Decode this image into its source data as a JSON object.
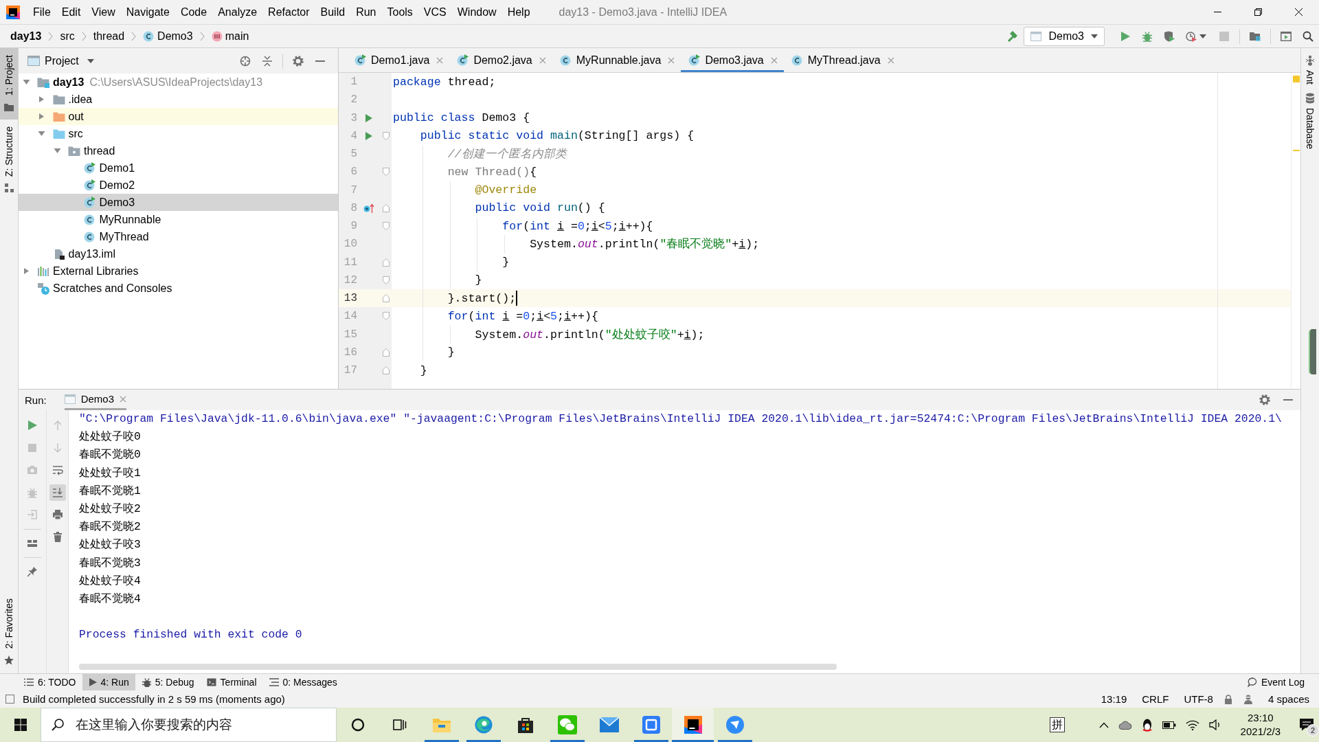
{
  "window": {
    "title": "day13 - Demo3.java - IntelliJ IDEA"
  },
  "menu": [
    "File",
    "Edit",
    "View",
    "Navigate",
    "Code",
    "Analyze",
    "Refactor",
    "Build",
    "Run",
    "Tools",
    "VCS",
    "Window",
    "Help"
  ],
  "breadcrumbs": [
    {
      "label": "day13",
      "kind": "project"
    },
    {
      "label": "src",
      "kind": "folder"
    },
    {
      "label": "thread",
      "kind": "folder"
    },
    {
      "label": "Demo3",
      "kind": "class"
    },
    {
      "label": "main",
      "kind": "method"
    }
  ],
  "toolbar": {
    "run_config": "Demo3",
    "buttons": [
      {
        "kind": "run",
        "disabled": false
      },
      {
        "kind": "debug",
        "disabled": false
      },
      {
        "kind": "coverage",
        "disabled": false
      },
      {
        "kind": "profile",
        "disabled": false
      },
      {
        "kind": "stop",
        "disabled": true
      },
      {
        "kind": "project-structure",
        "disabled": false
      },
      {
        "kind": "presentation",
        "disabled": false
      },
      {
        "kind": "search",
        "disabled": false
      }
    ]
  },
  "left_tool_tabs": [
    {
      "label": "1: Project",
      "kind": "project",
      "selected": true
    },
    {
      "label": "Z: Structure",
      "kind": "structure",
      "selected": false
    }
  ],
  "favorites_tab": {
    "label": "2: Favorites"
  },
  "right_tool_tabs": [
    {
      "label": "Ant",
      "kind": "ant"
    },
    {
      "label": "Database",
      "kind": "database"
    }
  ],
  "project_panel": {
    "title": "Project",
    "tree": [
      {
        "label": "day13",
        "path": "C:\\Users\\ASUS\\IdeaProjects\\day13",
        "kind": "module",
        "expanded": true,
        "selected": false,
        "children": [
          {
            "label": ".idea",
            "kind": "folder",
            "expanded": false,
            "selected": false
          },
          {
            "label": "out",
            "kind": "excluded-folder",
            "expanded": false,
            "selected": false
          },
          {
            "label": "src",
            "kind": "source-folder",
            "expanded": true,
            "selected": false,
            "children": [
              {
                "label": "thread",
                "kind": "package",
                "expanded": true,
                "selected": false,
                "children": [
                  {
                    "label": "Demo1",
                    "kind": "runnable-class",
                    "selected": false
                  },
                  {
                    "label": "Demo2",
                    "kind": "runnable-class",
                    "selected": false
                  },
                  {
                    "label": "Demo3",
                    "kind": "runnable-class",
                    "selected": true
                  },
                  {
                    "label": "MyRunnable",
                    "kind": "class",
                    "selected": false
                  },
                  {
                    "label": "MyThread",
                    "kind": "class",
                    "selected": false
                  }
                ]
              }
            ]
          },
          {
            "label": "day13.iml",
            "kind": "module-file",
            "selected": false
          }
        ]
      },
      {
        "label": "External Libraries",
        "kind": "libraries",
        "expanded": false,
        "selected": false
      },
      {
        "label": "Scratches and Consoles",
        "kind": "scratches",
        "selected": false
      }
    ]
  },
  "editor": {
    "tabs": [
      {
        "label": "Demo1.java",
        "kind": "runnable-class",
        "selected": false
      },
      {
        "label": "Demo2.java",
        "kind": "runnable-class",
        "selected": false
      },
      {
        "label": "MyRunnable.java",
        "kind": "class",
        "selected": false
      },
      {
        "label": "Demo3.java",
        "kind": "runnable-class",
        "selected": true
      },
      {
        "label": "MyThread.java",
        "kind": "class",
        "selected": false
      }
    ],
    "lines": [
      {
        "number": "1",
        "current": false,
        "tokens": [
          {
            "text": "package",
            "kind": "keyword"
          },
          {
            "text": " thread;",
            "kind": "plain"
          }
        ]
      },
      {
        "number": "2",
        "current": false
      },
      {
        "number": "3",
        "current": false,
        "markers": [
          {
            "kind": "run"
          }
        ],
        "tokens": [
          {
            "text": "public class",
            "kind": "keyword"
          },
          {
            "text": " Demo3 {",
            "kind": "plain"
          }
        ]
      },
      {
        "number": "4",
        "current": false,
        "markers": [
          {
            "kind": "run"
          },
          {
            "kind": "fold-open"
          }
        ],
        "tokens": [
          {
            "text": "    public static void ",
            "kind": "keyword"
          },
          {
            "text": "main",
            "kind": "method"
          },
          {
            "text": "(String[] args) {",
            "kind": "plain"
          }
        ]
      },
      {
        "number": "5",
        "current": false,
        "tokens": [
          {
            "text": "        //创建一个匿名内部类",
            "kind": "comment"
          }
        ]
      },
      {
        "number": "6",
        "current": false,
        "markers": [
          {
            "kind": "fold-open"
          }
        ],
        "tokens": [
          {
            "text": "        new Thread()",
            "kind": "dimmed"
          },
          {
            "text": "{",
            "kind": "plain"
          }
        ]
      },
      {
        "number": "7",
        "current": false,
        "tokens": [
          {
            "text": "            @Override",
            "kind": "annotation"
          }
        ]
      },
      {
        "number": "8",
        "current": false,
        "markers": [
          {
            "kind": "override"
          },
          {
            "kind": "fold-close"
          }
        ],
        "tokens": [
          {
            "text": "            public void ",
            "kind": "keyword"
          },
          {
            "text": "run",
            "kind": "method"
          },
          {
            "text": "() {",
            "kind": "plain"
          }
        ]
      },
      {
        "number": "9",
        "current": false,
        "markers": [
          {
            "kind": "fold-open"
          }
        ],
        "tokens": [
          {
            "text": "                for",
            "kind": "keyword"
          },
          {
            "text": "(",
            "kind": "plain"
          },
          {
            "text": "int ",
            "kind": "keyword"
          },
          {
            "text": "i",
            "kind": "variable"
          },
          {
            "text": " =",
            "kind": "plain"
          },
          {
            "text": "0",
            "kind": "number"
          },
          {
            "text": ";",
            "kind": "plain"
          },
          {
            "text": "i",
            "kind": "variable"
          },
          {
            "text": "<",
            "kind": "plain"
          },
          {
            "text": "5",
            "kind": "number"
          },
          {
            "text": ";",
            "kind": "plain"
          },
          {
            "text": "i",
            "kind": "variable"
          },
          {
            "text": "++){",
            "kind": "plain"
          }
        ]
      },
      {
        "number": "10",
        "current": false,
        "tokens": [
          {
            "text": "                    System.",
            "kind": "plain"
          },
          {
            "text": "out",
            "kind": "field"
          },
          {
            "text": ".println(",
            "kind": "plain"
          },
          {
            "text": "\"春眠不觉晓\"",
            "kind": "string"
          },
          {
            "text": "+",
            "kind": "plain"
          },
          {
            "text": "i",
            "kind": "variable"
          },
          {
            "text": ");",
            "kind": "plain"
          }
        ]
      },
      {
        "number": "11",
        "current": false,
        "markers": [
          {
            "kind": "fold-close"
          }
        ],
        "tokens": [
          {
            "text": "                }",
            "kind": "plain"
          }
        ]
      },
      {
        "number": "12",
        "current": false,
        "markers": [
          {
            "kind": "fold-open"
          }
        ],
        "tokens": [
          {
            "text": "            }",
            "kind": "plain"
          }
        ]
      },
      {
        "number": "13",
        "current": true,
        "markers": [
          {
            "kind": "fold-close"
          }
        ],
        "tokens": [
          {
            "text": "        }.start();",
            "kind": "plain"
          }
        ]
      },
      {
        "number": "14",
        "current": false,
        "markers": [
          {
            "kind": "fold-open"
          }
        ],
        "tokens": [
          {
            "text": "        for",
            "kind": "keyword"
          },
          {
            "text": "(",
            "kind": "plain"
          },
          {
            "text": "int ",
            "kind": "keyword"
          },
          {
            "text": "i",
            "kind": "variable"
          },
          {
            "text": " =",
            "kind": "plain"
          },
          {
            "text": "0",
            "kind": "number"
          },
          {
            "text": ";",
            "kind": "plain"
          },
          {
            "text": "i",
            "kind": "variable"
          },
          {
            "text": "<",
            "kind": "plain"
          },
          {
            "text": "5",
            "kind": "number"
          },
          {
            "text": ";",
            "kind": "plain"
          },
          {
            "text": "i",
            "kind": "variable"
          },
          {
            "text": "++){",
            "kind": "plain"
          }
        ]
      },
      {
        "number": "15",
        "current": false,
        "tokens": [
          {
            "text": "            System.",
            "kind": "plain"
          },
          {
            "text": "out",
            "kind": "field"
          },
          {
            "text": ".println(",
            "kind": "plain"
          },
          {
            "text": "\"处处蚊子咬\"",
            "kind": "string"
          },
          {
            "text": "+",
            "kind": "plain"
          },
          {
            "text": "i",
            "kind": "variable"
          },
          {
            "text": ");",
            "kind": "plain"
          }
        ]
      },
      {
        "number": "16",
        "current": false,
        "markers": [
          {
            "kind": "fold-close"
          }
        ],
        "tokens": [
          {
            "text": "        }",
            "kind": "plain"
          }
        ]
      },
      {
        "number": "17",
        "current": false,
        "markers": [
          {
            "kind": "fold-close"
          }
        ],
        "tokens": [
          {
            "text": "    }",
            "kind": "plain"
          }
        ]
      }
    ]
  },
  "run_panel": {
    "label": "Run:",
    "tabs": [
      {
        "label": "Demo3",
        "selected": true
      }
    ],
    "actions": [
      {
        "kind": "rerun",
        "disabled": false
      },
      {
        "kind": "stop",
        "disabled": true
      },
      {
        "kind": "dump-threads",
        "disabled": true
      },
      {
        "kind": "debug-settings",
        "disabled": true
      },
      {
        "kind": "exit",
        "disabled": true
      },
      {
        "kind": "layout",
        "disabled": false
      },
      {
        "kind": "pin",
        "disabled": false
      }
    ],
    "console_actions": [
      {
        "kind": "up",
        "disabled": true,
        "selected": false
      },
      {
        "kind": "down",
        "disabled": true,
        "selected": false
      },
      {
        "kind": "soft-wrap",
        "disabled": false,
        "selected": false
      },
      {
        "kind": "scroll-to-end",
        "disabled": false,
        "selected": true
      },
      {
        "kind": "print",
        "disabled": false,
        "selected": false
      },
      {
        "kind": "clear",
        "disabled": false,
        "selected": false
      }
    ],
    "console": [
      {
        "kind": "command",
        "text": "\"C:\\Program Files\\Java\\jdk-11.0.6\\bin\\java.exe\" \"-javaagent:C:\\Program Files\\JetBrains\\IntelliJ IDEA 2020.1\\lib\\idea_rt.jar=52474:C:\\Program Files\\JetBrains\\IntelliJ IDEA 2020.1\\"
      },
      {
        "kind": "output",
        "text": "处处蚊子咬0"
      },
      {
        "kind": "output",
        "text": "春眠不觉晓0"
      },
      {
        "kind": "output",
        "text": "处处蚊子咬1"
      },
      {
        "kind": "output",
        "text": "春眠不觉晓1"
      },
      {
        "kind": "output",
        "text": "处处蚊子咬2"
      },
      {
        "kind": "output",
        "text": "春眠不觉晓2"
      },
      {
        "kind": "output",
        "text": "处处蚊子咬3"
      },
      {
        "kind": "output",
        "text": "春眠不觉晓3"
      },
      {
        "kind": "output",
        "text": "处处蚊子咬4"
      },
      {
        "kind": "output",
        "text": "春眠不觉晓4"
      },
      {
        "kind": "exit",
        "text": "Process finished with exit code 0"
      }
    ]
  },
  "bottom_tool_tabs": [
    {
      "label": "6: TODO",
      "kind": "todo",
      "selected": false
    },
    {
      "label": "4: Run",
      "kind": "run",
      "selected": true
    },
    {
      "label": "5: Debug",
      "kind": "debug",
      "selected": false
    },
    {
      "label": "Terminal",
      "kind": "terminal",
      "selected": false
    },
    {
      "label": "0: Messages",
      "kind": "messages",
      "selected": false
    }
  ],
  "event_log": {
    "label": "Event Log"
  },
  "status_bar": {
    "message": "Build completed successfully in 2 s 59 ms (moments ago)",
    "caret_position": "13:19",
    "line_separator": "CRLF",
    "encoding": "UTF-8",
    "indent": "4 spaces"
  },
  "taskbar": {
    "search_placeholder": "在这里输入你要搜索的内容",
    "apps": [
      {
        "kind": "cortana",
        "running": false,
        "active": false
      },
      {
        "kind": "task-view",
        "running": false,
        "active": false
      },
      {
        "kind": "explorer",
        "running": true,
        "active": false
      },
      {
        "kind": "edge",
        "running": true,
        "active": false
      },
      {
        "kind": "store",
        "running": false,
        "active": false
      },
      {
        "kind": "wechat",
        "running": true,
        "active": false
      },
      {
        "kind": "mail",
        "running": false,
        "active": false
      },
      {
        "kind": "wps",
        "running": true,
        "active": false
      },
      {
        "kind": "intellij",
        "running": true,
        "active": true
      },
      {
        "kind": "messenger",
        "running": true,
        "active": false
      }
    ],
    "ime": "拼",
    "time": "23:10",
    "date": "2021/2/3",
    "notifications": "2"
  }
}
